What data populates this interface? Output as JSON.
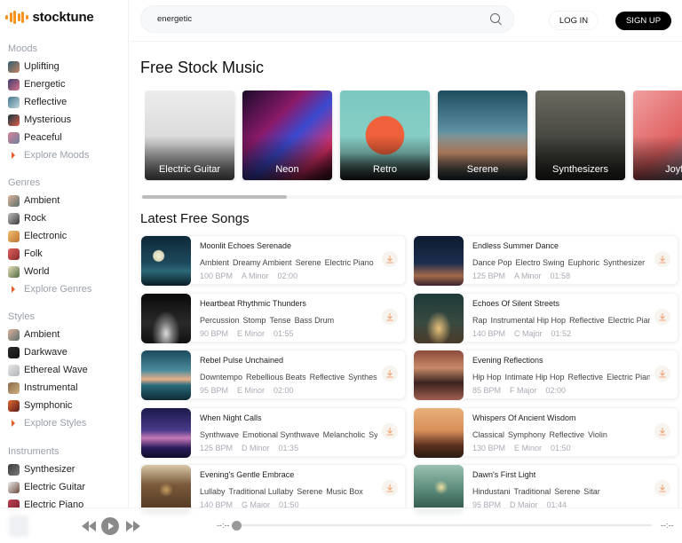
{
  "brand": {
    "name": "stocktune",
    "accent": "#f7931e"
  },
  "sidebar": {
    "moods": {
      "title": "Moods",
      "items": [
        {
          "label": "Uplifting",
          "colors": [
            "#2e5c6e",
            "#c98466"
          ]
        },
        {
          "label": "Energetic",
          "colors": [
            "#3d3a6a",
            "#d9738a"
          ]
        },
        {
          "label": "Reflective",
          "colors": [
            "#3e7a90",
            "#c6d4da"
          ]
        },
        {
          "label": "Mysterious",
          "colors": [
            "#0f3a3f",
            "#e05a4a"
          ]
        },
        {
          "label": "Peaceful",
          "colors": [
            "#d9839a",
            "#6e7e9a"
          ]
        }
      ],
      "explore": "Explore Moods"
    },
    "genres": {
      "title": "Genres",
      "items": [
        {
          "label": "Ambient",
          "colors": [
            "#e0b49a",
            "#5a6e6e"
          ]
        },
        {
          "label": "Rock",
          "colors": [
            "#bfbfbf",
            "#3a3a3a"
          ]
        },
        {
          "label": "Electronic",
          "colors": [
            "#f0c070",
            "#c07030"
          ]
        },
        {
          "label": "Folk",
          "colors": [
            "#e06060",
            "#8a2a2a"
          ]
        },
        {
          "label": "World",
          "colors": [
            "#f0e0c0",
            "#4a6a3a"
          ]
        }
      ],
      "explore": "Explore Genres"
    },
    "styles": {
      "title": "Styles",
      "items": [
        {
          "label": "Ambient",
          "colors": [
            "#e0b49a",
            "#5a6e6e"
          ]
        },
        {
          "label": "Darkwave",
          "colors": [
            "#2a2a2a",
            "#111111"
          ]
        },
        {
          "label": "Ethereal Wave",
          "colors": [
            "#e8e8e8",
            "#b0b4b8"
          ]
        },
        {
          "label": "Instrumental",
          "colors": [
            "#8a6a4a",
            "#d0b080"
          ]
        },
        {
          "label": "Symphonic",
          "colors": [
            "#e06a30",
            "#5a1a1a"
          ]
        }
      ],
      "explore": "Explore Styles"
    },
    "instruments": {
      "title": "Instruments",
      "items": [
        {
          "label": "Synthesizer",
          "colors": [
            "#3a3a3a",
            "#7a7a7a"
          ]
        },
        {
          "label": "Electric Guitar",
          "colors": [
            "#eeeeee",
            "#6a4a3a"
          ]
        },
        {
          "label": "Electric Piano",
          "colors": [
            "#c04050",
            "#7a2030"
          ]
        }
      ]
    }
  },
  "header": {
    "search_value": "energetic",
    "search_placeholder": "Search",
    "login": "LOG IN",
    "signup": "SIGN UP"
  },
  "main": {
    "title": "Free Stock Music",
    "categories": [
      {
        "label": "Electric Guitar",
        "bg": "linear-gradient(180deg,#ececec 0%,#d9d9d9 60%,#888 100%)"
      },
      {
        "label": "Neon",
        "bg": "linear-gradient(135deg,#1a0a2a 0%,#8a1a6a 35%,#3a4ad0 55%,#e0306a 80%,#2a0a1a 100%)"
      },
      {
        "label": "Retro",
        "bg": "radial-gradient(circle at 50% 50%,#f0603a 0%,#f0603a 30%,transparent 31%),linear-gradient(180deg,#7ac8c0 0%,#8ad0c6 70%,#222 100%)"
      },
      {
        "label": "Serene",
        "bg": "linear-gradient(180deg,#1f4e5f 0%,#5c8fa0 45%,#e3a27a 70%,#1d3646 100%)"
      },
      {
        "label": "Synthesizers",
        "bg": "linear-gradient(180deg,#6a6a60 0%,#4a4a44 50%,#2a2a26 100%)"
      },
      {
        "label": "Joyful",
        "bg": "linear-gradient(135deg,#f0a0a0 0%,#e06060 50%,#3aa0c0 100%)"
      }
    ],
    "latest_title": "Latest Free Songs",
    "songs": [
      {
        "title": "Moonlit Echoes Serenade",
        "tags": [
          "Ambient",
          "Dreamy Ambient",
          "Serene",
          "Electric Piano"
        ],
        "bpm": "100 BPM",
        "key": "A Minor",
        "duration": "02:00",
        "art": "radial-gradient(circle at 35% 40%,#f2f0d8 0%,#d8d6b8 12%,transparent 14%),linear-gradient(180deg,#0e2838 0%,#1e4a5e 55%,#2c6878 70%,#0b1c26 100%)"
      },
      {
        "title": "Endless Summer Dance",
        "tags": [
          "Dance Pop",
          "Electro Swing",
          "Euphoric",
          "Synthesizer"
        ],
        "bpm": "125 BPM",
        "key": "A Minor",
        "duration": "01:58",
        "art": "linear-gradient(180deg,#0d1a30 0%,#1c2e4e 55%,#a26a4a 80%,#3a2230 100%)"
      },
      {
        "title": "Heartbeat Rhythmic Thunders",
        "tags": [
          "Percussion",
          "Stomp",
          "Tense",
          "Bass Drum"
        ],
        "bpm": "90 BPM",
        "key": "E Minor",
        "duration": "01:55",
        "art": "radial-gradient(ellipse at 50% 80%,#dcdcdc 0%,#707070 20%,transparent 40%),linear-gradient(180deg,#0a0a0a 0%,#2a2a2a 60%,#111 100%)"
      },
      {
        "title": "Echoes Of Silent Streets",
        "tags": [
          "Rap",
          "Instrumental Hip Hop",
          "Reflective",
          "Electric Piano"
        ],
        "bpm": "140 BPM",
        "key": "C Major",
        "duration": "01:52",
        "art": "radial-gradient(ellipse at 50% 70%,#e8c27a 0%,transparent 35%),linear-gradient(180deg,#1e3a3a 0%,#3a4a40 60%,#4a3a2a 100%)"
      },
      {
        "title": "Rebel Pulse Unchained",
        "tags": [
          "Downtempo",
          "Rebellious Beats",
          "Reflective",
          "Synthesizer"
        ],
        "bpm": "95 BPM",
        "key": "E Minor",
        "duration": "02:00",
        "art": "linear-gradient(180deg,#1c4a5e 0%,#4a8a9a 40%,#e8b08a 58%,#2a6a7a 70%,#0e2a36 100%)"
      },
      {
        "title": "Evening Reflections",
        "tags": [
          "Hip Hop",
          "Intimate Hip Hop",
          "Reflective",
          "Electric Piano"
        ],
        "bpm": "85 BPM",
        "key": "F Major",
        "duration": "02:00",
        "art": "linear-gradient(180deg,#8a4a3a 0%,#c88a6a 35%,#3a2220 65%,#a06050 100%)"
      },
      {
        "title": "When Night Calls",
        "tags": [
          "Synthwave",
          "Emotional Synthwave",
          "Melancholic",
          "Synthesizer"
        ],
        "bpm": "125 BPM",
        "key": "D Minor",
        "duration": "01:35",
        "art": "linear-gradient(180deg,#1a1a4a 0%,#4a3a8a 45%,#c87ab8 60%,#2a1a5a 80%,#0e0e2a 100%)"
      },
      {
        "title": "Whispers Of Ancient Wisdom",
        "tags": [
          "Classical",
          "Symphony",
          "Reflective",
          "Violin"
        ],
        "bpm": "130 BPM",
        "key": "E Minor",
        "duration": "01:50",
        "art": "linear-gradient(180deg,#e8b07a 0%,#d8905a 45%,#5a3020 75%,#2a1a10 100%)"
      },
      {
        "title": "Evening's Gentle Embrace",
        "tags": [
          "Lullaby",
          "Traditional Lullaby",
          "Serene",
          "Music Box"
        ],
        "bpm": "140 BPM",
        "key": "G Major",
        "duration": "01:50",
        "art": "radial-gradient(circle at 50% 50%,#c8a060 0%,transparent 20%),linear-gradient(180deg,#d8c8a8 0%,#7a5a3a 40%,#4a3220 100%)"
      },
      {
        "title": "Dawn's First Light",
        "tags": [
          "Hindustani",
          "Traditional",
          "Serene",
          "Sitar"
        ],
        "bpm": "95 BPM",
        "key": "D Major",
        "duration": "01:44",
        "art": "radial-gradient(circle at 55% 45%,#f0e0a0 0%,transparent 18%),linear-gradient(180deg,#9ac0b0 0%,#5a8a7a 50%,#2a4a40 100%)"
      }
    ]
  },
  "player": {
    "current_time": "--:--",
    "total_time": "--:--",
    "progress": 0
  }
}
